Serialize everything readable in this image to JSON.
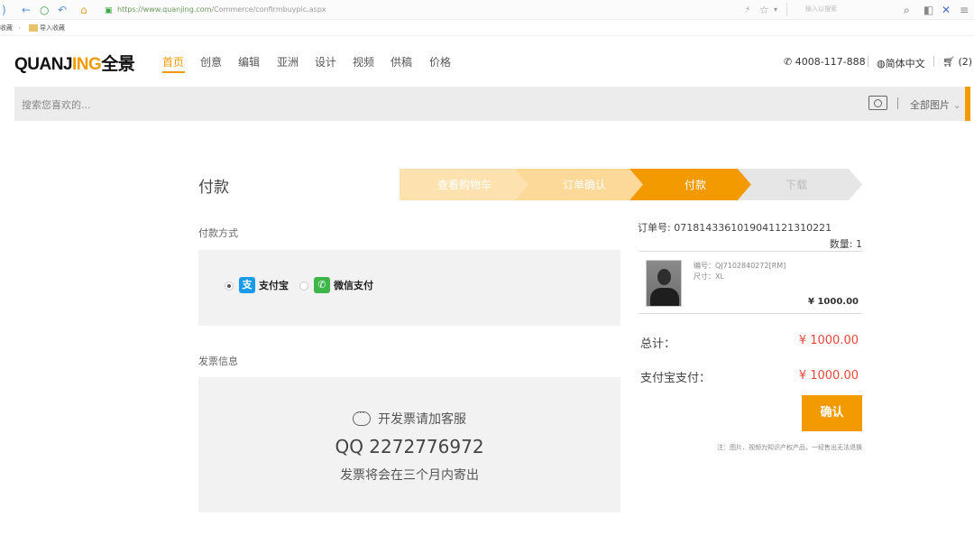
{
  "browser": {
    "url_host": "https://www.quanjing.com",
    "url_path": "/Commerce/confirmbuypic.aspx",
    "search_placeholder": "输入以搜索",
    "favorites_label": "收藏",
    "favorites_import": "导入收藏"
  },
  "site": {
    "logo_main": "QUANJ",
    "logo_accent": "ING",
    "logo_cn": "全景"
  },
  "nav": {
    "items": [
      "首页",
      "创意",
      "编辑",
      "亚洲",
      "设计",
      "视频",
      "供稿",
      "价格"
    ],
    "active_index": 0
  },
  "header": {
    "phone": "4008-117-888",
    "language": "简体中文",
    "cart": "(2)"
  },
  "search": {
    "placeholder": "搜索您喜欢的...",
    "scope": "全部图片"
  },
  "page": {
    "title": "付款"
  },
  "steps": {
    "items": [
      "查看购物车",
      "订单确认",
      "付款",
      "下载"
    ],
    "active_index": 2
  },
  "payment": {
    "label": "付款方式",
    "alipay": "支付宝",
    "wechat": "微信支付",
    "selected": "alipay"
  },
  "invoice": {
    "label": "发票信息",
    "line1": "开发票请加客服",
    "line2": "QQ 2272776972",
    "line3": "发票将会在三个月内寄出"
  },
  "order": {
    "number": "订单号: 071814336101904112131022​1",
    "quantity": "数量: 1",
    "item_code": "编号：QJ7102840272[RM]",
    "item_size": "尺寸：XL",
    "item_price": "¥ 1000.00",
    "total_label": "总计：",
    "total_value": "¥ 1000.00",
    "pay_label": "支付宝支付：",
    "pay_value": "¥ 1000.00",
    "confirm": "确认",
    "note": "注：图片、视频为知识产权产品，一经售出无法退换"
  },
  "colors": {
    "accent": "#f39a00",
    "price": "#e8483a"
  }
}
